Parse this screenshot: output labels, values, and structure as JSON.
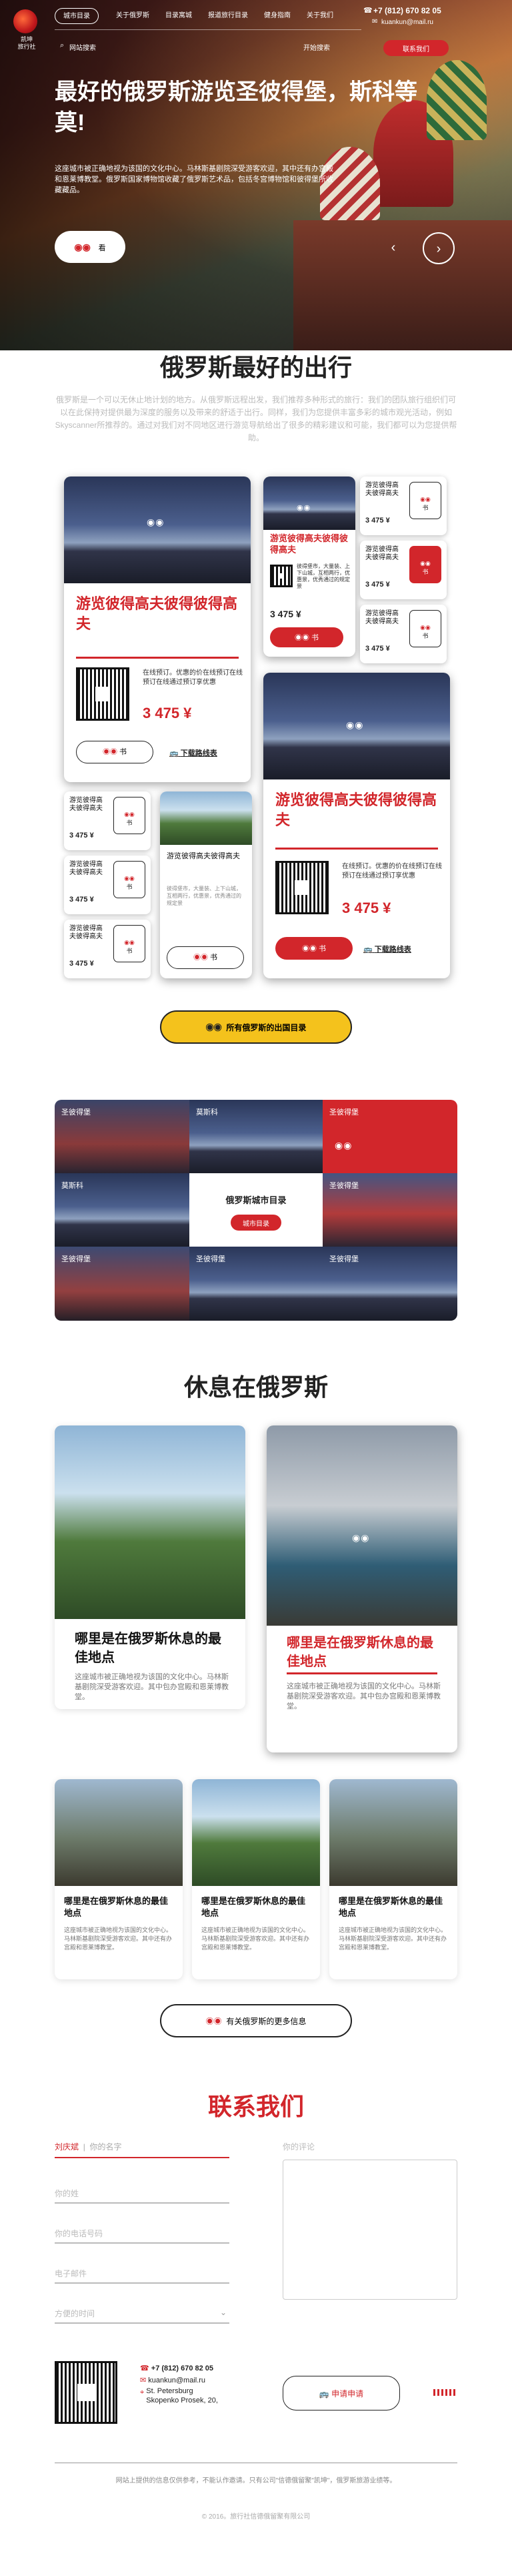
{
  "brand": {
    "name": "凯坤\n旅行社"
  },
  "nav": {
    "items": [
      "城市目录",
      "关于俄罗斯",
      "目录寓城",
      "报道旅行目录",
      "健身指南",
      "关于我们"
    ],
    "row2": [
      "网站搜索",
      "开始搜索"
    ]
  },
  "contact_top": {
    "phone": "+7 (812) 670 82 05",
    "email": "kuankun@mail.ru",
    "button": "联系我们"
  },
  "hero": {
    "title": "最好的俄罗斯游览圣彼得堡，斯科等莫!",
    "text": "这座城市被正确地视为该国的文化中心。马林斯基剧院深受游客欢迎，其中还有办宫殿和恩莱博教堂。俄罗斯国家博物馆收藏了俄罗斯艺术品，包括冬宫博物馆和彼得堡所收藏藏品。",
    "button": "看",
    "prev": "‹",
    "next": "›"
  },
  "trips": {
    "title": "俄罗斯最好的出行",
    "intro": "俄罗斯是一个可以无休止地计划的地方。从俄罗斯远程出发，我们推荐多种形式的旅行：我们的团队旅行组织们可以在此保持对提供最为深度的服务以及带来的舒适于出行。同样，我们为您提供丰富多彩的城市观光活动，例如Skyscanner所推荐的。通过对我们对不同地区进行游览导航给出了很多的精彩建议和可能，我们都可以为您提供帮助。",
    "card_title": "游览彼得高夫彼得彼得高夫",
    "card_text": "在线预订。优惠的价在线预订在线预订在线通过预订享优惠",
    "price": "3 475 ¥",
    "book": "书",
    "route": "下载路线表",
    "mini_title": "游览彼得高夫彼得高夫",
    "mini_text": "彼得堡市，大量装、上下山城，互相两行，优惠景，优秀通过的规定景",
    "mini_price": "3 475 ¥",
    "all_button": "所有俄罗斯的出国目录"
  },
  "grid": {
    "cells": [
      "圣彼得堡",
      "莫斯科",
      "圣彼得堡",
      "莫斯科",
      "圣彼得堡",
      "圣彼得堡",
      "圣彼得堡",
      "圣彼得堡"
    ],
    "center_title": "俄罗斯城市目录",
    "center_button": "城市目录"
  },
  "rest": {
    "title": "休息在俄罗斯",
    "big_title": "哪里是在俄罗斯休息的最佳地点",
    "big_text": "这座城市被正确地视为该国的文化中心。马林斯基剧院深受游客欢迎。其中包办宫殿和恩莱博教堂。",
    "small_title": "哪里是在俄罗斯休息的最佳地点",
    "small_text": "这座城市被正确地视为该国的文化中心。马林斯基剧院深受游客欢迎。其中还有办宫殿和恩莱博教堂。",
    "more_button": "有关俄罗斯的更多信息"
  },
  "contact": {
    "title": "联系我们",
    "tabs": [
      "刘庆斌",
      "你的名字"
    ],
    "fields": [
      "你的姓",
      "你的电话号码",
      "电子邮件",
      "方便的时间"
    ],
    "comment": "你的评论",
    "submit": "申请申请",
    "phone": "+7 (812) 670 82 05",
    "email": "kuankun@mail.ru",
    "address": "St. Petersburg\nSkopenko Prosek, 20,",
    "disclaimer": "网站上提供的信息仅供参考，不能认作邀请。只有公司\"信德俄留聚\"凯坤\"，俄罗斯旅游业绩等。",
    "copyright": "© 2016。旅行社信德俄留聚有限公司"
  },
  "colors": {
    "accent": "#d2262b",
    "yellow": "#f4c21c"
  }
}
